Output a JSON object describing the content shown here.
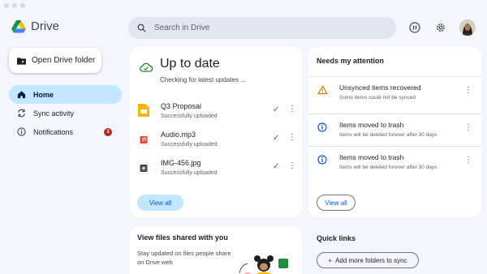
{
  "app": {
    "name": "Drive"
  },
  "search": {
    "placeholder": "Search in Drive"
  },
  "header": {
    "pause_icon": "pause-circle-icon",
    "settings_icon": "gear-icon",
    "avatar": "user-avatar"
  },
  "open_folder": {
    "label": "Open Drive folder"
  },
  "nav": {
    "items": [
      {
        "label": "Home",
        "icon": "home-icon",
        "active": true
      },
      {
        "label": "Sync activity",
        "icon": "sync-icon"
      },
      {
        "label": "Notifications",
        "icon": "info-icon",
        "badge": "3"
      }
    ]
  },
  "sync": {
    "title": "Up to date",
    "subtitle": "Checking for latest updates ...",
    "files": [
      {
        "name": "Q3 Proposal",
        "status": "Successfully uploaded",
        "icon": "slides-file-icon",
        "color": "#f4b400"
      },
      {
        "name": "Audio.mp3",
        "status": "Successfully uploaded",
        "icon": "audio-file-icon",
        "color": "#ea4335"
      },
      {
        "name": "IMG-456.jpg",
        "status": "Successfully uploaded",
        "icon": "image-file-icon",
        "color": "#444746"
      }
    ],
    "view_all": "View all"
  },
  "attention": {
    "title": "Needs my attention",
    "items": [
      {
        "title": "Unsynced items recovered",
        "desc": "Some items could not be synced",
        "icon": "warning-icon"
      },
      {
        "title": "Items moved to trash",
        "desc": "Items will be deleted forever after 30 days",
        "icon": "info-icon"
      },
      {
        "title": "Items moved to trash",
        "desc": "Items will be deleted forever after 30 days",
        "icon": "info-icon"
      }
    ],
    "view_all": "View all"
  },
  "shared": {
    "title": "View files shared with you",
    "desc": "Stay updated on files people share on Drive web"
  },
  "quick_links": {
    "title": "Quick links",
    "add_label": "Add more folders to sync"
  },
  "colors": {
    "accent": "#0b57d0",
    "active_bg": "#c2e7ff",
    "background": "#f3f6fc",
    "check": "#188038",
    "warning": "#e37400"
  }
}
